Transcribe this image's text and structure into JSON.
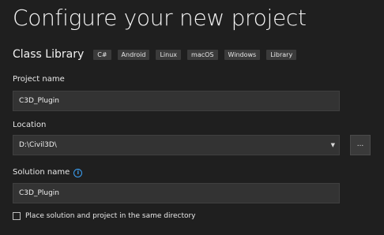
{
  "header": {
    "title": "Configure your new project"
  },
  "template": {
    "name": "Class Library",
    "tags": [
      "C#",
      "Android",
      "Linux",
      "macOS",
      "Windows",
      "Library"
    ]
  },
  "project_name": {
    "label": "Project name",
    "value": "C3D_Plugin"
  },
  "location": {
    "label": "Location",
    "value": "D:\\Civil3D\\",
    "dropdown_icon": "chevron-down-icon",
    "browse_label": "..."
  },
  "solution_name": {
    "label": "Solution name",
    "info_icon": "info-icon",
    "info_glyph": "i",
    "value": "C3D_Plugin"
  },
  "same_directory": {
    "label": "Place solution and project in the same directory",
    "checked": false
  },
  "colors": {
    "background": "#1f1f1f",
    "input_background": "#333333",
    "tag_background": "#3b3b3b",
    "accent_info": "#3ba0f5"
  }
}
